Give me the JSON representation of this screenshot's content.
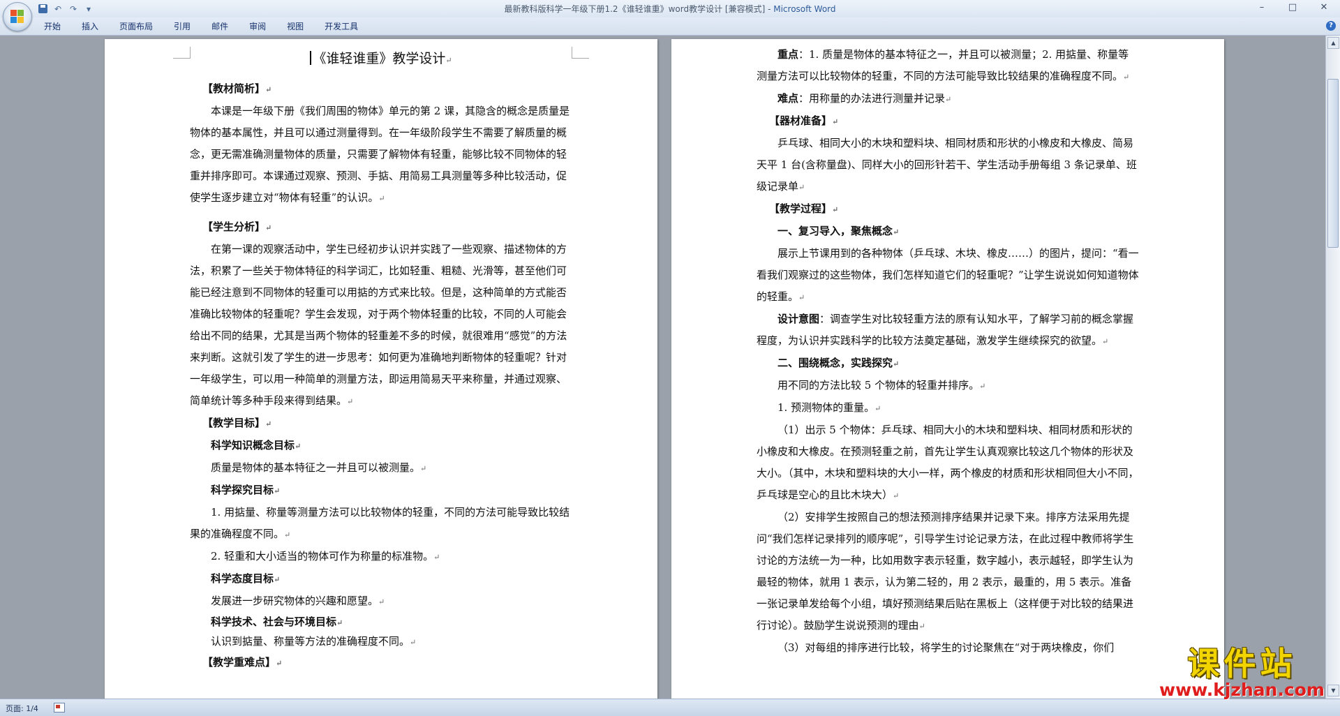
{
  "window": {
    "title": "最新教科版科学一年级下册1.2《谁轻谁重》word教学设计 [兼容模式]",
    "app_name": "Microsoft Word",
    "controls": {
      "minimize": "–",
      "maximize": "□",
      "close": "✕"
    }
  },
  "qat": {
    "undo": "↶",
    "redo": "↷",
    "more": "▾"
  },
  "ribbon": {
    "tabs": [
      "开始",
      "插入",
      "页面布局",
      "引用",
      "邮件",
      "审阅",
      "视图",
      "开发工具"
    ],
    "help": "?"
  },
  "left_page": {
    "title": "《谁轻谁重》教学设计",
    "h_material": "【教材简析】",
    "p_material": "本课是一年级下册《我们周围的物体》单元的第 2 课，其隐含的概念是质量是物体的基本属性，并且可以通过测量得到。在一年级阶段学生不需要了解质量的概念，更无需准确测量物体的质量，只需要了解物体有轻重，能够比较不同物体的轻重并排序即可。本课通过观察、预测、手掂、用简易工具测量等多种比较活动，促使学生逐步建立对“物体有轻重”的认识。",
    "h_student": "【学生分析】",
    "p_student": "在第一课的观察活动中，学生已经初步认识并实践了一些观察、描述物体的方法，积累了一些关于物体特征的科学词汇，比如轻重、粗糙、光滑等，甚至他们可能已经注意到不同物体的轻重可以用掂的方式来比较。但是，这种简单的方式能否准确比较物体的轻重呢？学生会发现，对于两个物体轻重的比较，不同的人可能会给出不同的结果，尤其是当两个物体的轻重差不多的时候，就很难用“感觉”的方法来判断。这就引发了学生的进一步思考：如何更为准确地判断物体的轻重呢？针对一年级学生，可以用一种简单的测量方法，即运用简易天平来称量，并通过观察、简单统计等多种手段来得到结果。",
    "h_goal": "【教学目标】",
    "g1_title": "科学知识概念目标",
    "g1_text": "质量是物体的基本特征之一并且可以被测量。",
    "g2_title": "科学探究目标",
    "g2_text1": "1. 用掂量、称量等测量方法可以比较物体的轻重，不同的方法可能导致比较结果的准确程度不同。",
    "g2_text2": "2. 轻重和大小适当的物体可作为称量的标准物。",
    "g3_title": "科学态度目标",
    "g3_text": "发展进一步研究物体的兴趣和愿望。",
    "g4_title": "科学技术、社会与环境目标",
    "g4_text": "认识到掂量、称量等方法的准确程度不同。",
    "h_keypoint": "【教学重难点】"
  },
  "right_page": {
    "key_label": "重点",
    "key_text": "：1. 质量是物体的基本特征之一，并且可以被测量；2. 用掂量、称量等测量方法可以比较物体的轻重，不同的方法可能导致比较结果的准确程度不同。",
    "diff_label": "难点",
    "diff_text": "：用称量的办法进行测量并记录",
    "h_equip": "【器材准备】",
    "p_equip": "乒乓球、相同大小的木块和塑料块、相同材质和形状的小橡皮和大橡皮、简易天平 1 台(含称量盘)、同样大小的回形针若干、学生活动手册每组 3 条记录单、班级记录单",
    "h_process": "【教学过程】",
    "s1_title": "一、复习导入，聚焦概念",
    "s1_text": "展示上节课用到的各种物体（乒乓球、木块、橡皮……）的图片，提问：“看一看我们观察过的这些物体，我们怎样知道它们的轻重呢？”让学生说说如何知道物体的轻重。",
    "design_label": "设计意图",
    "design_text": "：调查学生对比较轻重方法的原有认知水平，了解学习前的概念掌握程度，为认识并实践科学的比较方法奠定基础，激发学生继续探究的欲望。",
    "s2_title": "二、围绕概念，实践探究",
    "s2_intro": "用不同的方法比较 5 个物体的轻重并排序。",
    "s2_step1": "1. 预测物体的重量。",
    "s2_p1": "（1）出示 5 个物体：乒乓球、相同大小的木块和塑料块、相同材质和形状的小橡皮和大橡皮。在预测轻重之前，首先让学生认真观察比较这几个物体的形状及大小。（其中，木块和塑料块的大小一样，两个橡皮的材质和形状相同但大小不同，乒乓球是空心的且比木块大）",
    "s2_p2": "（2）安排学生按照自己的想法预测排序结果并记录下来。排序方法采用先提问“我们怎样记录排列的顺序呢”，引导学生讨论记录方法，在此过程中教师将学生讨论的方法统一为一种，比如用数字表示轻重，数字越小，表示越轻，即学生认为最轻的物体，就用 1 表示，认为第二轻的，用 2 表示，最重的，用 5 表示。准备一张记录单发给每个小组，填好预测结果后贴在黑板上（这样便于对比较的结果进行讨论）。鼓励学生说说预测的理由",
    "s2_p3": "（3）对每组的排序进行比较，将学生的讨论聚焦在“对于两块橡皮，你们"
  },
  "status": {
    "page": "页面: 1/4"
  },
  "watermark": {
    "main": "课件站",
    "url": "www.kjzhan.com"
  },
  "colors": {
    "title_brand": "#2e5b9a",
    "watermark_yellow": "#f2d400",
    "watermark_red": "#e01d1d"
  }
}
